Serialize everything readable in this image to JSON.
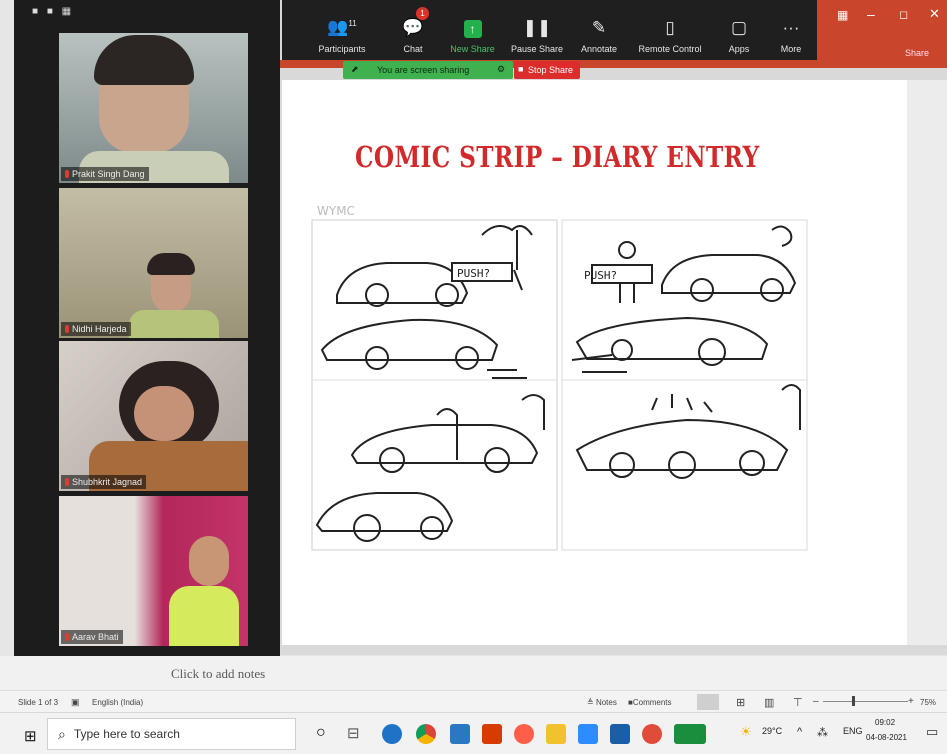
{
  "window_icons": "■ ■ ▦",
  "toolbar": {
    "items": [
      {
        "label": "Participants",
        "icon": "participants-icon",
        "glyph": "👥",
        "count": "11"
      },
      {
        "label": "Chat",
        "icon": "chat-icon",
        "glyph": "💬",
        "badge": "1"
      },
      {
        "label": "New Share",
        "icon": "share-icon",
        "glyph": "↑"
      },
      {
        "label": "Pause Share",
        "icon": "pause-icon",
        "glyph": "❚❚"
      },
      {
        "label": "Annotate",
        "icon": "annotate-icon",
        "glyph": "✎"
      },
      {
        "label": "Remote Control",
        "icon": "remote-control-icon",
        "glyph": "🖱"
      },
      {
        "label": "Apps",
        "icon": "apps-icon",
        "glyph": "▢"
      },
      {
        "label": "More",
        "icon": "more-icon",
        "glyph": "···"
      }
    ],
    "share_label_color": "#4ec26a"
  },
  "share_banner": {
    "text": "You are screen sharing",
    "stop": "Stop Share"
  },
  "share_corner": "Share",
  "participants": [
    {
      "name": "Prakit Singh Dang"
    },
    {
      "name": "Nidhi Harjeda"
    },
    {
      "name": "Shubhkrit Jagnad"
    },
    {
      "name": "Aarav Bhati"
    }
  ],
  "slide": {
    "title": "COMIC STRIP – DIARY ENTRY",
    "signature": "WYMC",
    "push_sign": "PUSH?"
  },
  "notes": {
    "placeholder": "Click to add notes"
  },
  "status": {
    "slide": "Slide 1 of 3",
    "language": "English (India)",
    "notes": "Notes",
    "comments": "Comments",
    "zoom": "75%"
  },
  "taskbar": {
    "search": "Type here to search",
    "temperature": "29°C",
    "lang": "ENG",
    "time": "09:02",
    "date": "04-08-2021"
  },
  "colors": {
    "accent_red": "#d12a2a",
    "zoom_green": "#3fb24f",
    "toolbar_bg": "#1f1f1f"
  }
}
